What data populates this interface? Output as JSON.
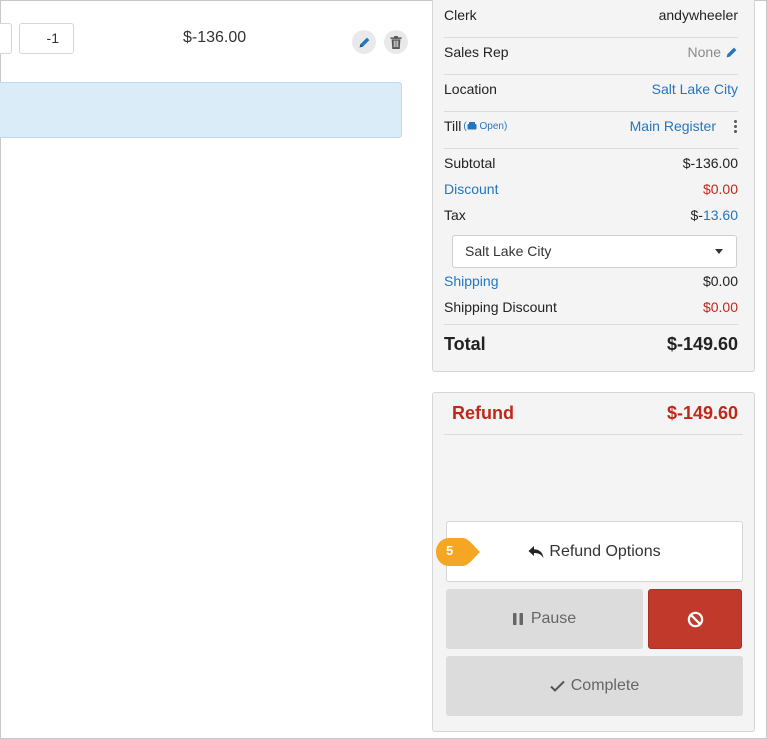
{
  "line_item": {
    "quantity": "-1",
    "price": "$-136.00"
  },
  "summary": {
    "clerk_label": "Clerk",
    "clerk_value": "andywheeler",
    "sales_rep_label": "Sales Rep",
    "sales_rep_value": "None",
    "location_label": "Location",
    "location_value": "Salt Lake City",
    "till_label": "Till",
    "till_status": "Open",
    "till_value": "Main Register",
    "subtotal_label": "Subtotal",
    "subtotal_value": "$-136.00",
    "discount_label": "Discount",
    "discount_value": "$0.00",
    "tax_label": "Tax",
    "tax_prefix": "$-",
    "tax_value": "13.60",
    "tax_region_selected": "Salt Lake City",
    "shipping_label": "Shipping",
    "shipping_value": "$0.00",
    "shipping_discount_label": "Shipping Discount",
    "shipping_discount_value": "$0.00",
    "total_label": "Total",
    "total_value": "$-149.60"
  },
  "refund": {
    "label": "Refund",
    "value": "$-149.60",
    "options_label": "Refund Options",
    "pause_label": "Pause",
    "complete_label": "Complete"
  },
  "callout": {
    "step_number": "5"
  },
  "colors": {
    "accent_blue": "#2476c0",
    "refund_red": "#c0281c",
    "cancel_red": "#c0392b",
    "callout_orange": "#f5a623",
    "info_bar_blue": "#d9ecf7"
  }
}
